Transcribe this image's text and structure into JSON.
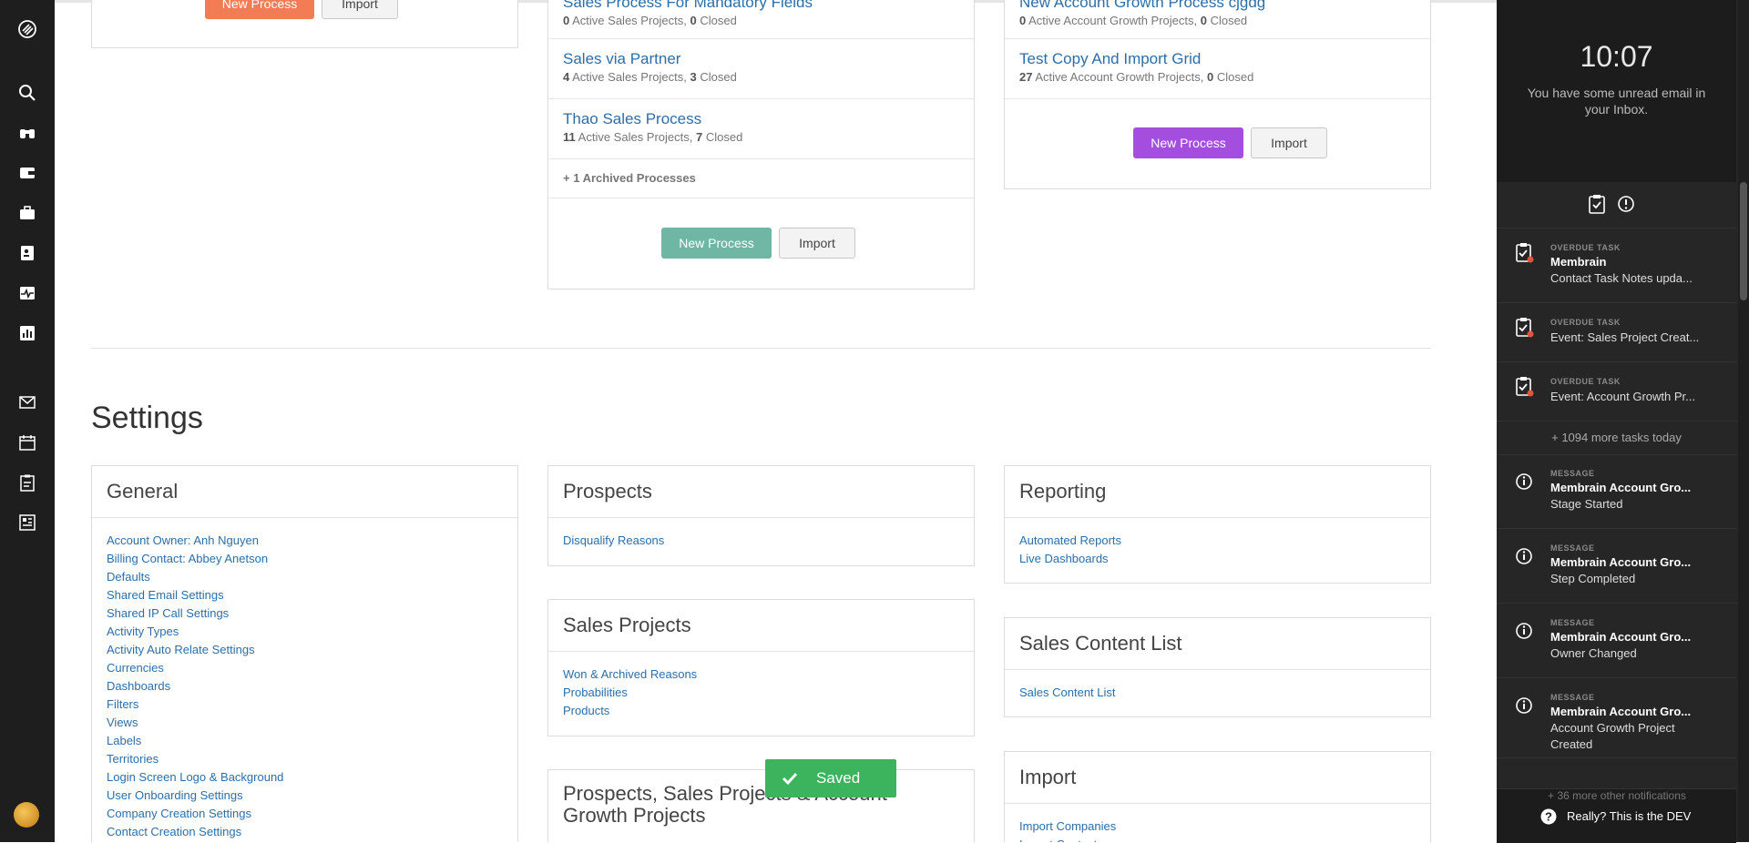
{
  "colors": {
    "orange_button": "#f47c55",
    "teal_button": "#6fb6a5",
    "purple_button": "#a44ee0",
    "link": "#2d6ea8",
    "toast": "#3cb35d"
  },
  "nav": {
    "icons": [
      "logo-icon",
      "search-icon",
      "binoculars-icon",
      "wallet-icon",
      "briefcase-icon",
      "contact-card-icon",
      "activity-icon",
      "report-icon",
      "mail-icon",
      "calendar-icon",
      "clipboard-icon",
      "dashboard-icon"
    ]
  },
  "left_card": {
    "new_process": "New Process",
    "import": "Import"
  },
  "sales_processes": {
    "items": [
      {
        "title": "Sales Process For Mandatory Fields",
        "active": "0",
        "active_label": "Active Sales Projects,",
        "closed": "0",
        "closed_label": "Closed"
      },
      {
        "title": "Sales via Partner",
        "active": "4",
        "active_label": "Active Sales Projects,",
        "closed": "3",
        "closed_label": "Closed"
      },
      {
        "title": "Thao Sales Process",
        "active": "11",
        "active_label": "Active Sales Projects,",
        "closed": "7",
        "closed_label": "Closed"
      }
    ],
    "archived": "+ 1 Archived Processes",
    "new_process": "New Process",
    "import": "Import"
  },
  "account_growth": {
    "items": [
      {
        "title": "New Account Growth Process cjgdg",
        "active": "0",
        "active_label": "Active Account Growth Projects,",
        "closed": "0",
        "closed_label": "Closed"
      },
      {
        "title": "Test Copy And Import Grid",
        "active": "27",
        "active_label": "Active Account Growth Projects,",
        "closed": "0",
        "closed_label": "Closed"
      }
    ],
    "new_process": "New Process",
    "import": "Import"
  },
  "settings": {
    "heading": "Settings",
    "general": {
      "title": "General",
      "links": [
        "Account Owner: Anh Nguyen",
        "Billing Contact: Abbey Anetson",
        "Defaults",
        "Shared Email Settings",
        "Shared IP Call Settings",
        "Activity Types",
        "Activity Auto Relate Settings",
        "Currencies",
        "Dashboards",
        "Filters",
        "Views",
        "Labels",
        "Territories",
        "Login Screen Logo & Background",
        "User Onboarding Settings",
        "Company Creation Settings",
        "Contact Creation Settings"
      ]
    },
    "prospects": {
      "title": "Prospects",
      "links": [
        "Disqualify Reasons"
      ]
    },
    "sales_projects": {
      "title": "Sales Projects",
      "links": [
        "Won & Archived Reasons",
        "Probabilities",
        "Products"
      ]
    },
    "combined": {
      "title": "Prospects, Sales Projects & Account Growth Projects"
    },
    "reporting": {
      "title": "Reporting",
      "links": [
        "Automated Reports",
        "Live Dashboards"
      ]
    },
    "sales_content": {
      "title": "Sales Content List",
      "links": [
        "Sales Content List"
      ]
    },
    "import": {
      "title": "Import",
      "links": [
        "Import Companies",
        "Import Contacts"
      ]
    }
  },
  "toast": {
    "text": "Saved"
  },
  "right_panel": {
    "clock": "10:07",
    "email_msg": "You have some unread email in your Inbox.",
    "notifications": [
      {
        "kind": "OVERDUE TASK",
        "title": "Membrain",
        "body": "Contact Task Notes upda...",
        "icon": "task-icon"
      },
      {
        "kind": "OVERDUE TASK",
        "title": "",
        "body": "Event: Sales Project Creat...",
        "icon": "task-icon"
      },
      {
        "kind": "OVERDUE TASK",
        "title": "",
        "body": "Event: Account Growth Pr...",
        "icon": "task-icon"
      }
    ],
    "more_tasks": "+ 1094 more tasks today",
    "messages": [
      {
        "kind": "MESSAGE",
        "title": "Membrain Account Gro...",
        "body": "Stage Started",
        "icon": "info-icon"
      },
      {
        "kind": "MESSAGE",
        "title": "Membrain Account Gro...",
        "body": "Step Completed",
        "icon": "info-icon"
      },
      {
        "kind": "MESSAGE",
        "title": "Membrain Account Gro...",
        "body": "Owner Changed",
        "icon": "info-icon"
      },
      {
        "kind": "MESSAGE",
        "title": "Membrain Account Gro...",
        "body": "Account Growth Project",
        "body2": "Created",
        "icon": "info-icon"
      }
    ],
    "more_notifications": "+ 36 more other notifications",
    "footer": "Really? This is the DEV"
  }
}
